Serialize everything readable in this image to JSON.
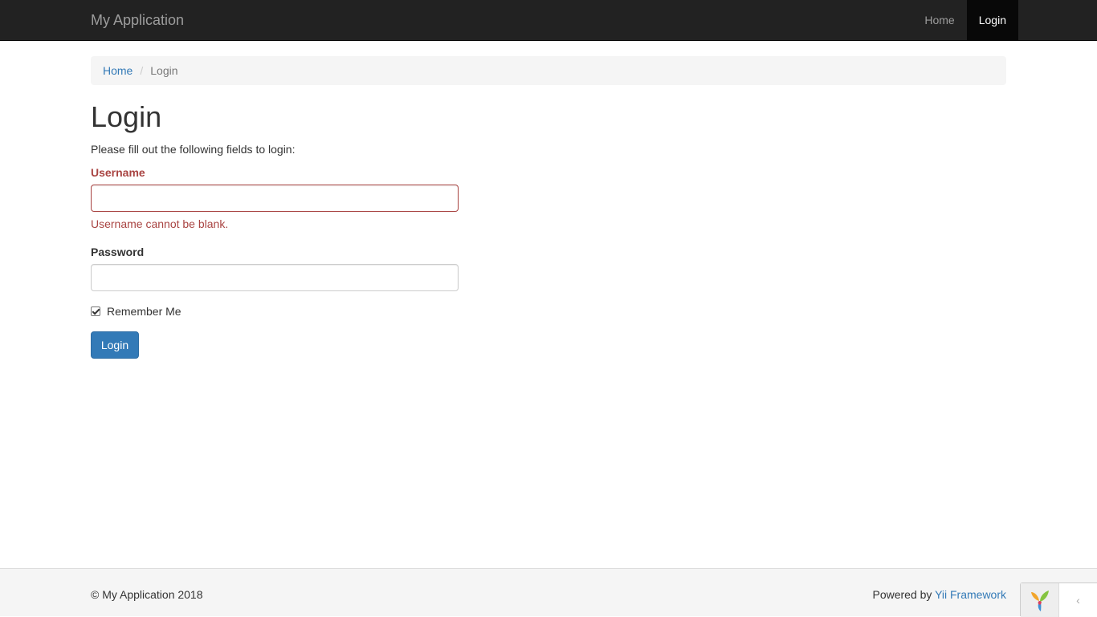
{
  "navbar": {
    "brand": "My Application",
    "items": [
      {
        "label": "Home",
        "active": false
      },
      {
        "label": "Login",
        "active": true
      }
    ]
  },
  "breadcrumb": {
    "home": "Home",
    "separator": "/",
    "current": "Login"
  },
  "page": {
    "title": "Login",
    "intro": "Please fill out the following fields to login:"
  },
  "form": {
    "username": {
      "label": "Username",
      "value": "",
      "error": "Username cannot be blank."
    },
    "password": {
      "label": "Password",
      "value": ""
    },
    "remember": {
      "label": "Remember Me",
      "checked": true
    },
    "submit_label": "Login"
  },
  "footer": {
    "copyright": "© My Application 2018",
    "powered_prefix": "Powered by ",
    "framework_link": "Yii Framework"
  },
  "debug_toolbar": {
    "logo_icon": "yii-logo-icon",
    "toggle_icon": "chevron-left-icon",
    "toggle_glyph": "‹"
  },
  "colors": {
    "navbar_bg": "#222222",
    "primary": "#337ab7",
    "error": "#a94442"
  }
}
